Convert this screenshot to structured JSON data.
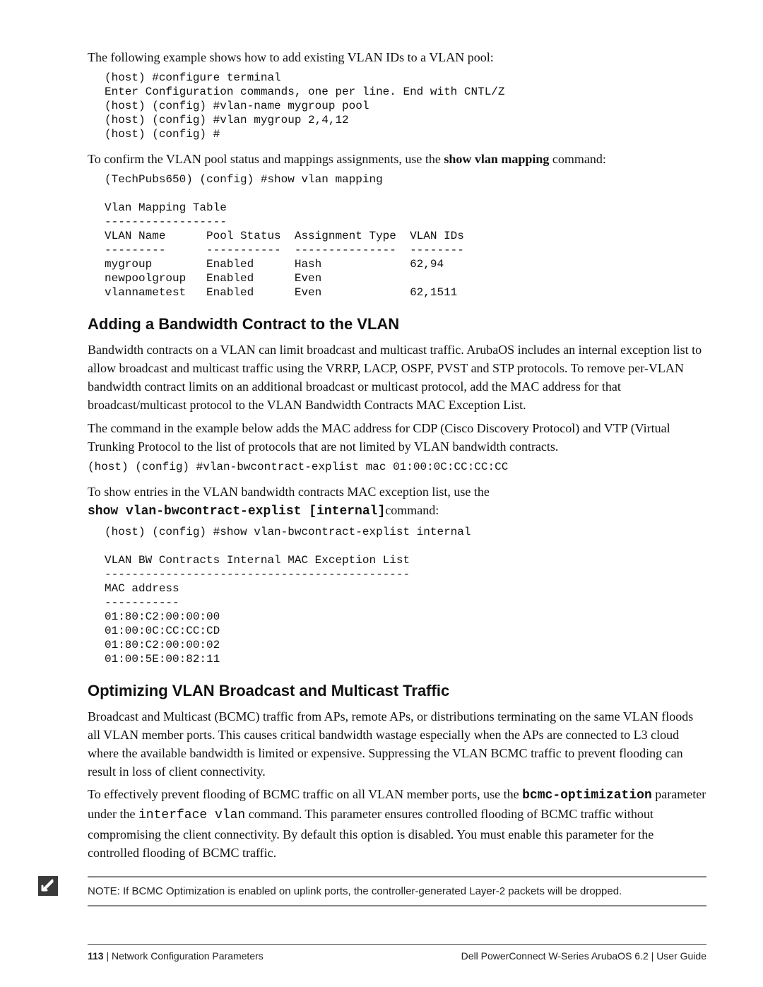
{
  "intro1": "The following example shows how to add existing VLAN IDs to a VLAN pool:",
  "code1": "(host) #configure terminal\nEnter Configuration commands, one per line. End with CNTL/Z\n(host) (config) #vlan-name mygroup pool\n(host) (config) #vlan mygroup 2,4,12\n(host) (config) #",
  "confirm_pre": "To confirm the VLAN pool status and mappings assignments, use the ",
  "confirm_cmd": "show vlan mapping",
  "confirm_post": " command:",
  "code2": "(TechPubs650) (config) #show vlan mapping\n\nVlan Mapping Table\n------------------\nVLAN Name      Pool Status  Assignment Type  VLAN IDs\n---------      -----------  ---------------  --------\nmygroup        Enabled      Hash             62,94\nnewpoolgroup   Enabled      Even\nvlannametest   Enabled      Even             62,1511",
  "sect1": "Adding a Bandwidth Contract to the VLAN",
  "p1": "Bandwidth contracts on a VLAN can limit broadcast and multicast traffic. ArubaOS includes an internal exception list to allow broadcast and multicast traffic using the VRRP, LACP, OSPF, PVST and STP protocols. To remove per-VLAN bandwidth contract limits on an additional broadcast or multicast protocol, add the MAC address for that broadcast/multicast protocol to the VLAN Bandwidth Contracts MAC Exception List.",
  "p2": "The command in the example below adds the MAC address for CDP (Cisco Discovery Protocol) and VTP (Virtual Trunking Protocol to the list of protocols that are not limited by VLAN bandwidth contracts.",
  "code3": "(host) (config) #vlan-bwcontract-explist mac 01:00:0C:CC:CC:CC",
  "p3a": "To show entries in the VLAN bandwidth contracts MAC exception list, use the",
  "p3cmd": "show vlan-bwcontract-explist [internal]",
  "p3b": "command:",
  "code4": "(host) (config) #show vlan-bwcontract-explist internal\n\nVLAN BW Contracts Internal MAC Exception List\n---------------------------------------------\nMAC address\n-----------\n01:80:C2:00:00:00\n01:00:0C:CC:CC:CD\n01:80:C2:00:00:02\n01:00:5E:00:82:11",
  "sect2": "Optimizing VLAN Broadcast and Multicast Traffic",
  "p4": "Broadcast and Multicast (BCMC) traffic from APs, remote APs, or distributions terminating on the same VLAN floods all VLAN member ports. This causes critical bandwidth wastage especially when the APs are connected to L3 cloud where the available bandwidth is limited or expensive. Suppressing the VLAN BCMC traffic to prevent flooding can result in loss of client connectivity.",
  "p5_pre": "To effectively prevent flooding of BCMC traffic on all VLAN member ports, use the ",
  "p5_cmd1": "bcmc-optimization",
  "p5_mid": " parameter under the ",
  "p5_cmd2": "interface vlan",
  "p5_post": " command. This parameter ensures controlled flooding of BCMC traffic without compromising the client connectivity. By default this option is disabled. You must enable this parameter for the controlled flooding of BCMC traffic.",
  "note": "NOTE: If BCMC Optimization is enabled on uplink ports, the controller-generated Layer-2 packets will be dropped.",
  "footer_left_page": "113",
  "footer_left_sep": " | ",
  "footer_left_title": "Network Configuration Parameters",
  "footer_right_product": "Dell PowerConnect W-Series ArubaOS 6.2",
  "footer_right_sep": "  |  ",
  "footer_right_guide": "User Guide"
}
